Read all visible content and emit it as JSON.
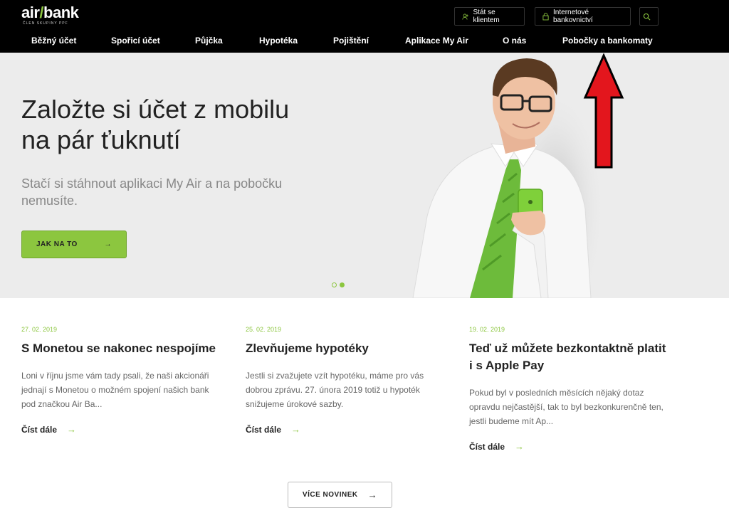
{
  "header": {
    "logo_main": "air",
    "logo_slash": "/",
    "logo_bank": "bank",
    "logo_sub": "ČLEN SKUPINY PPF",
    "client_button": "Stát se klientem",
    "internet_banking_button": "Internetové bankovnictví"
  },
  "nav": {
    "items": [
      "Běžný účet",
      "Spořicí účet",
      "Půjčka",
      "Hypotéka",
      "Pojištění",
      "Aplikace My Air",
      "O nás",
      "Pobočky a bankomaty"
    ]
  },
  "hero": {
    "title": "Založte si účet z mobilu na pár ťuknutí",
    "subtitle": "Stačí si stáhnout aplikaci My Air a na pobočku nemusíte.",
    "cta_label": "JAK NA TO",
    "slide_count": 2,
    "active_slide": 2
  },
  "news": [
    {
      "date": "27. 02. 2019",
      "title": "S Monetou se nakonec nespojíme",
      "text": "Loni v říjnu jsme vám tady psali, že naši akcionáři jednají s Monetou o možném spojení našich bank pod značkou Air Ba...",
      "more": "Číst dále"
    },
    {
      "date": "25. 02. 2019",
      "title": "Zlevňujeme hypotéky",
      "text": "Jestli si zvažujete vzít hypotéku, máme pro vás dobrou zprávu. 27. února 2019 totiž u hypoték snižujeme úrokové sazby.",
      "more": "Číst dále"
    },
    {
      "date": "19. 02. 2019",
      "title": "Teď už můžete bezkontaktně platit i s Apple Pay",
      "text": "Pokud byl v posledních měsících nějaký dotaz opravdu nejčastější, tak to byl bezkonkurenčně ten, jestli budeme mít Ap...",
      "more": "Číst dále"
    }
  ],
  "more_news_label": "VÍCE NOVINEK",
  "colors": {
    "accent": "#8cc63f",
    "header_bg": "#000000",
    "annotation_arrow": "#e3161d"
  }
}
